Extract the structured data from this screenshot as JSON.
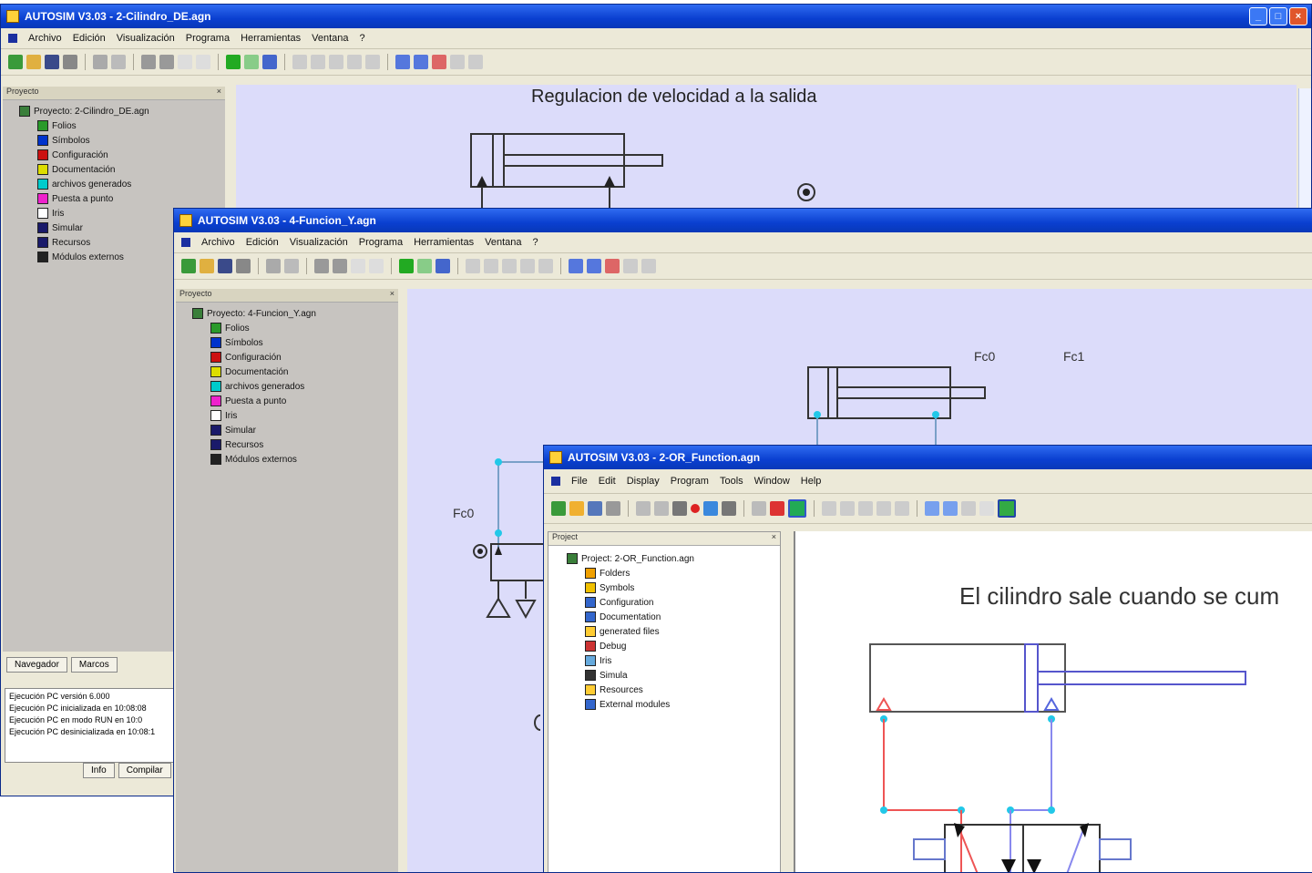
{
  "win1": {
    "title": "AUTOSIM V3.03 - 2-Cilindro_DE.agn",
    "menu": [
      "Archivo",
      "Edición",
      "Visualización",
      "Programa",
      "Herramientas",
      "Ventana",
      "?"
    ],
    "project_panel_title": "Proyecto",
    "tree": [
      {
        "label": "Proyecto: 2-Cilindro_DE.agn",
        "color": "#3a7f3a"
      },
      {
        "label": "Folios",
        "color": "#2a9a2a"
      },
      {
        "label": "Símbolos",
        "color": "#0033cc"
      },
      {
        "label": "Configuración",
        "color": "#cc1111"
      },
      {
        "label": "Documentación",
        "color": "#dddd00"
      },
      {
        "label": "archivos generados",
        "color": "#00cccc"
      },
      {
        "label": "Puesta a punto",
        "color": "#ee22cc"
      },
      {
        "label": "Iris",
        "color": "#ffffff"
      },
      {
        "label": "Simular",
        "color": "#1a1a6a"
      },
      {
        "label": "Recursos",
        "color": "#1a1a6a"
      },
      {
        "label": "Módulos externos",
        "color": "#222222"
      }
    ],
    "canvas_title": "Regulacion de velocidad a la salida",
    "tabs": [
      "Navegador",
      "Marcos"
    ],
    "log_lines": [
      "Ejecución PC versión 6.000",
      "Ejecución PC inicializada en 10:08:08",
      "Ejecución PC en modo RUN en 10:0",
      "Ejecución PC desinicializada en 10:08:1"
    ],
    "bottom_tabs": [
      "Info",
      "Compilar"
    ]
  },
  "win2": {
    "title": "AUTOSIM V3.03 - 4-Funcion_Y.agn",
    "menu": [
      "Archivo",
      "Edición",
      "Visualización",
      "Programa",
      "Herramientas",
      "Ventana",
      "?"
    ],
    "project_panel_title": "Proyecto",
    "tree": [
      {
        "label": "Proyecto: 4-Funcion_Y.agn",
        "color": "#3a7f3a"
      },
      {
        "label": "Folios",
        "color": "#2a9a2a"
      },
      {
        "label": "Símbolos",
        "color": "#0033cc"
      },
      {
        "label": "Configuración",
        "color": "#cc1111"
      },
      {
        "label": "Documentación",
        "color": "#dddd00"
      },
      {
        "label": "archivos generados",
        "color": "#00cccc"
      },
      {
        "label": "Puesta a punto",
        "color": "#ee22cc"
      },
      {
        "label": "Iris",
        "color": "#ffffff"
      },
      {
        "label": "Simular",
        "color": "#1a1a6a"
      },
      {
        "label": "Recursos",
        "color": "#1a1a6a"
      },
      {
        "label": "Módulos externos",
        "color": "#222222"
      }
    ],
    "labels": {
      "fc0_top": "Fc0",
      "fc1_top": "Fc1",
      "fc0_left": "Fc0"
    }
  },
  "win3": {
    "title": "AUTOSIM V3.03 - 2-OR_Function.agn",
    "menu": [
      "File",
      "Edit",
      "Display",
      "Program",
      "Tools",
      "Window",
      "Help"
    ],
    "project_panel_title": "Project",
    "tree": [
      {
        "label": "Project: 2-OR_Function.agn",
        "color": "#3a7f3a"
      },
      {
        "label": "Folders",
        "color": "#f0a000"
      },
      {
        "label": "Symbols",
        "color": "#f0c000"
      },
      {
        "label": "Configuration",
        "color": "#3366cc"
      },
      {
        "label": "Documentation",
        "color": "#3366cc"
      },
      {
        "label": "generated files",
        "color": "#ffcc33"
      },
      {
        "label": "Debug",
        "color": "#cc3333"
      },
      {
        "label": "Iris",
        "color": "#66aadd"
      },
      {
        "label": "Simula",
        "color": "#333333"
      },
      {
        "label": "Resources",
        "color": "#ffcc33"
      },
      {
        "label": "External modules",
        "color": "#3366cc"
      }
    ],
    "canvas_title": "El cilindro sale cuando se cum"
  }
}
